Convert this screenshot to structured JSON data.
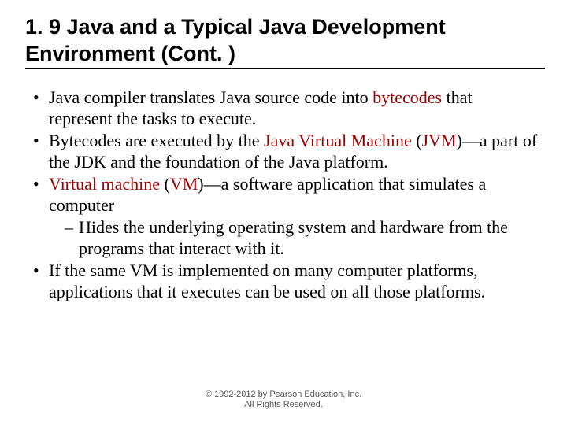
{
  "title": "1. 9  Java and a Typical Java Development Environment (Cont. )",
  "bullets": [
    {
      "pre": "Java compiler translates Java source code into ",
      "term": "bytecodes",
      "post": " that represent the tasks to execute."
    },
    {
      "pre": "Bytecodes are executed by the ",
      "term": "Java Virtual Machine",
      "mid": " (",
      "term2": "JVM",
      "post": ")—a part of the JDK and the foundation of the Java platform."
    },
    {
      "term": "Virtual machine",
      "mid": " (",
      "term2": "VM",
      "post": ")—a software application that simulates a computer",
      "sub": "Hides the underlying operating system and hardware from the programs that interact with it."
    },
    {
      "pre": "If the same VM is implemented on many computer platforms, applications that it executes can be used on all those platforms."
    }
  ],
  "footer": {
    "line1": "© 1992-2012 by Pearson Education, Inc.",
    "line2": "All Rights Reserved."
  }
}
